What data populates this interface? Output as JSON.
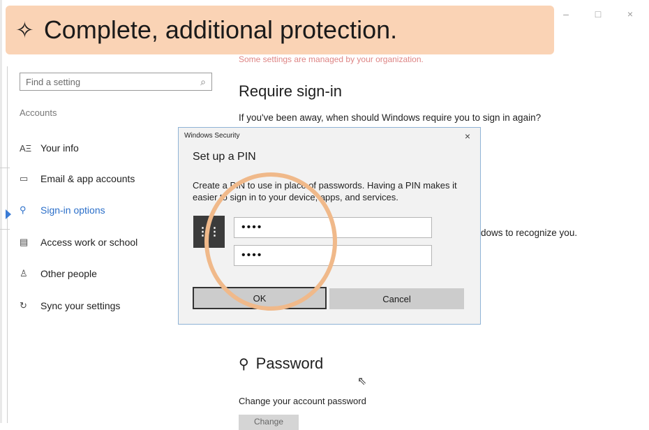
{
  "banner": {
    "star": "✧",
    "text": "Complete, additional protection."
  },
  "window": {
    "minimize": "–",
    "maximize": "□",
    "close": "×"
  },
  "org_notice": "Some settings are managed by your organization.",
  "search": {
    "placeholder": "Find a setting",
    "icon": "search-icon"
  },
  "sidebar": {
    "header": "Accounts",
    "items": [
      {
        "icon": "AΞ",
        "icon_name": "person-card-icon",
        "label": "Your info",
        "active": false
      },
      {
        "icon": "▭",
        "icon_name": "mail-icon",
        "label": "Email & app accounts",
        "active": false
      },
      {
        "icon": "🔍",
        "icon_name": "key-icon",
        "label": "Sign-in options",
        "active": true
      },
      {
        "icon": "▤",
        "icon_name": "briefcase-icon",
        "label": "Access work or school",
        "active": false
      },
      {
        "icon": "♙",
        "icon_name": "people-icon",
        "label": "Other people",
        "active": false
      },
      {
        "icon": "↻",
        "icon_name": "sync-icon",
        "label": "Sync your settings",
        "active": false
      }
    ]
  },
  "main": {
    "require_title": "Require sign-in",
    "require_question": "If you've been away, when should Windows require you to sign in again?",
    "recognize_text": "dows to recognize you.",
    "password_title": "Password",
    "password_desc": "Change your account password",
    "change_label": "Change"
  },
  "dialog": {
    "caption": "Windows Security",
    "close": "×",
    "heading": "Set up a PIN",
    "body": "Create a PIN to use in place of passwords. Having a PIN makes it easier to sign in to your device, apps, and services.",
    "pin_icon": "⋮⋮",
    "pin_value": "••••",
    "confirm_value": "••••",
    "ok_label": "OK",
    "cancel_label": "Cancel"
  },
  "colors": {
    "banner": "#fad3b5",
    "accent": "#2b6fc9",
    "circle": "#f0b98a"
  }
}
